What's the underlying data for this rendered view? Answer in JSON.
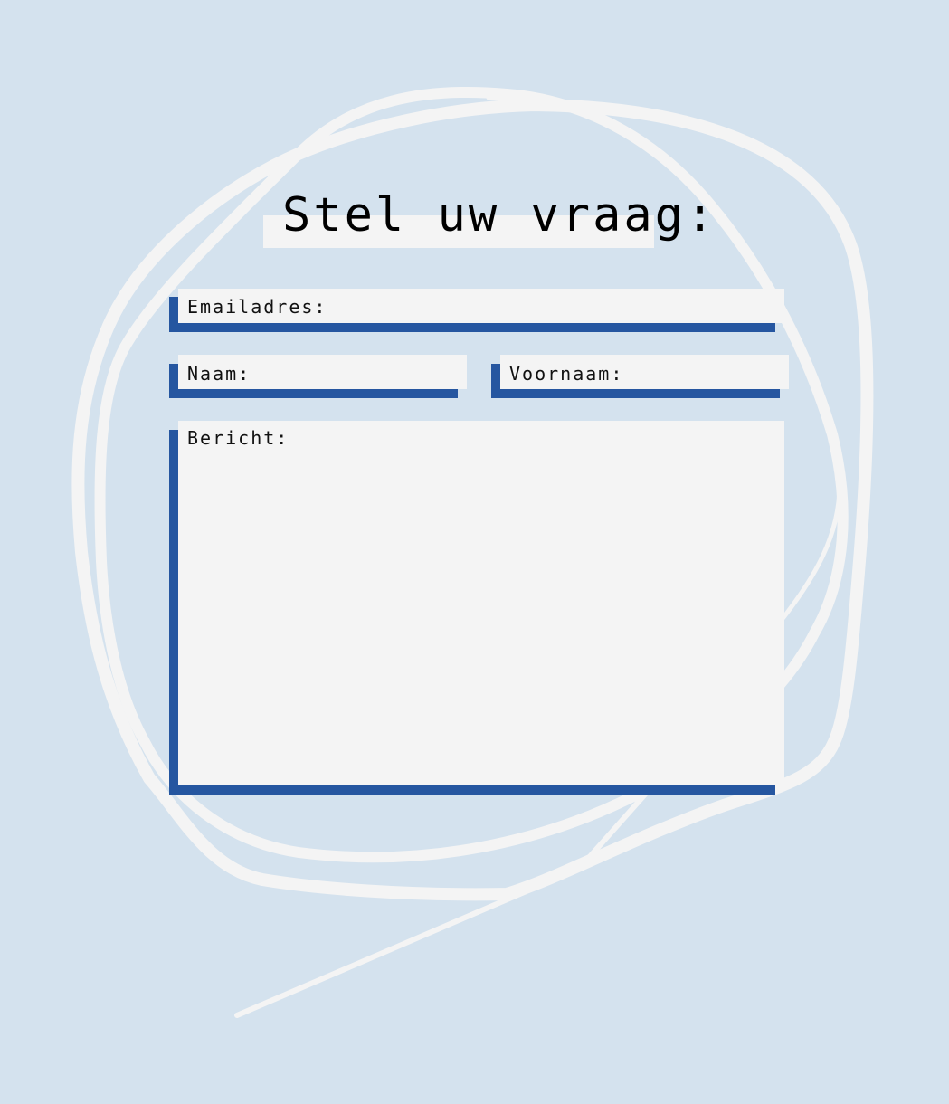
{
  "page": {
    "title": "Stel uw vraag:",
    "background_color": "#d4e2ee",
    "accent_color": "#2556a0",
    "field_color": "#f4f4f4"
  },
  "form": {
    "email_label": "Emailadres:",
    "email_value": "",
    "naam_label": "Naam:",
    "naam_value": "",
    "voornaam_label": "Voornaam:",
    "voornaam_value": "",
    "bericht_label": "Bericht:",
    "bericht_value": ""
  }
}
